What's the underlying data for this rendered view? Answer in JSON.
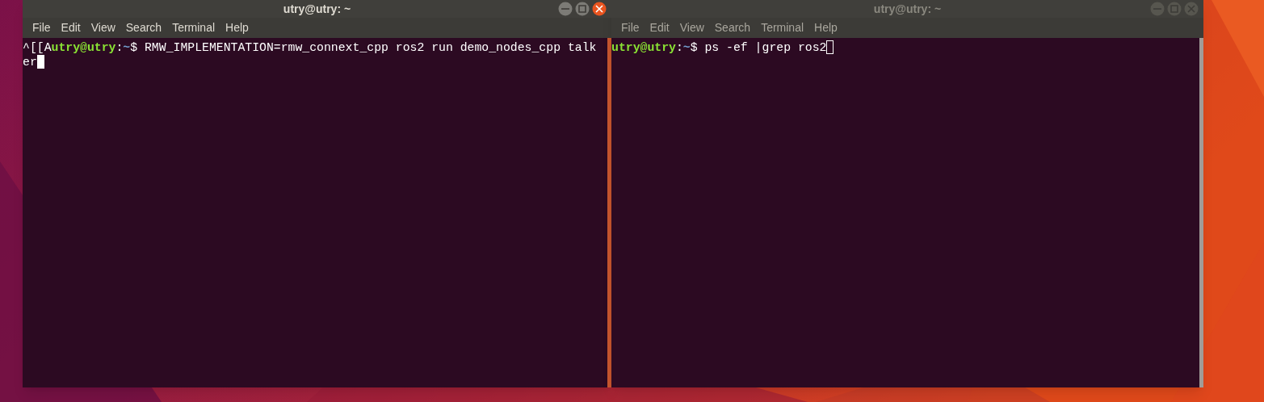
{
  "windows": [
    {
      "title": "utry@utry: ~",
      "focused": true,
      "menu": [
        "File",
        "Edit",
        "View",
        "Search",
        "Terminal",
        "Help"
      ],
      "lines": [
        [
          {
            "kind": "plain",
            "text": "^[[A"
          },
          {
            "kind": "user",
            "text": "utry@utry"
          },
          {
            "kind": "plain",
            "text": ":"
          },
          {
            "kind": "path",
            "text": "~"
          },
          {
            "kind": "plain",
            "text": "$ RMW_IMPLEMENTATION=rmw_connext_cpp ros2 run demo_nodes_cpp talk"
          }
        ],
        [
          {
            "kind": "plain",
            "text": "er"
          },
          {
            "kind": "cursor"
          }
        ]
      ]
    },
    {
      "title": "utry@utry: ~",
      "focused": false,
      "menu": [
        "File",
        "Edit",
        "View",
        "Search",
        "Terminal",
        "Help"
      ],
      "lines": [
        [
          {
            "kind": "user",
            "text": "utry@utry"
          },
          {
            "kind": "plain",
            "text": ":"
          },
          {
            "kind": "path",
            "text": "~"
          },
          {
            "kind": "plain",
            "text": "$ ps -ef |grep ros2"
          },
          {
            "kind": "cursor"
          }
        ]
      ]
    }
  ]
}
